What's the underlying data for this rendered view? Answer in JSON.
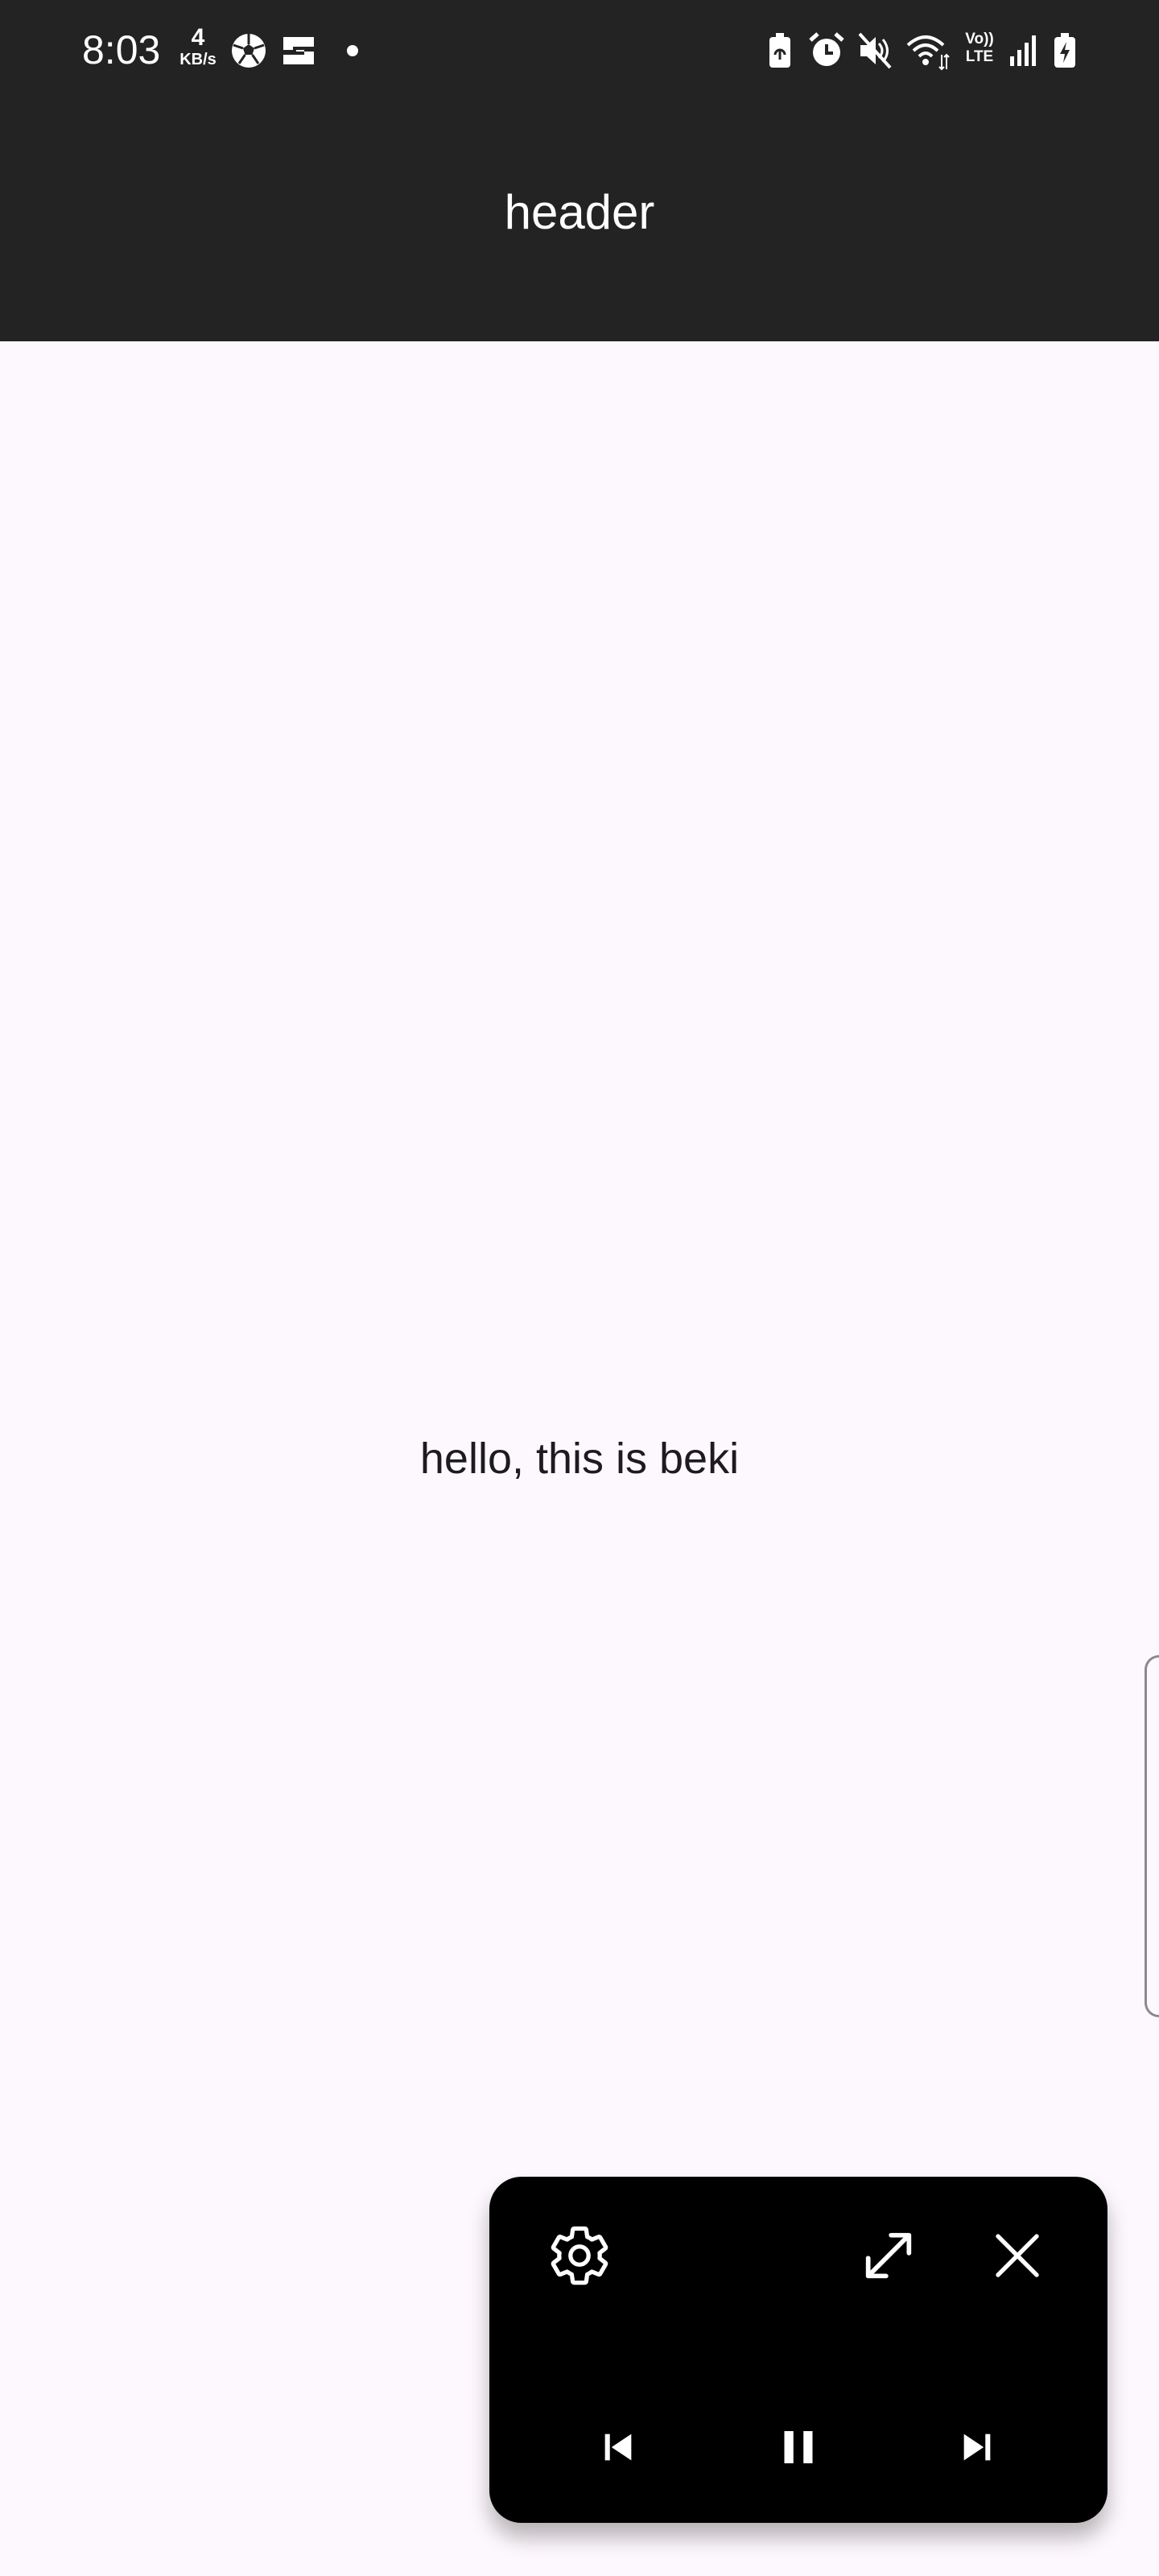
{
  "status_bar": {
    "time": "8:03",
    "net_speed_value": "4",
    "net_speed_unit": "KB/s",
    "left_icons": [
      "soccer-ball-icon",
      "app-s-icon",
      "dot-icon"
    ],
    "right_icons": [
      "battery-saver-icon",
      "alarm-icon",
      "mute-icon",
      "wifi-icon",
      "volte-icon",
      "signal-icon",
      "battery-charging-icon"
    ],
    "volte_line1": "Vo))",
    "volte_line2": "LTE"
  },
  "header": {
    "title": "header",
    "background": "#232323"
  },
  "main": {
    "text": "hello, this is beki",
    "background": "#fdf8fd"
  },
  "mini_player": {
    "background": "#000000",
    "top_controls": [
      "settings-icon",
      "expand-icon",
      "close-icon"
    ],
    "bottom_controls": [
      "skip-previous-icon",
      "pause-icon",
      "skip-next-icon"
    ]
  }
}
